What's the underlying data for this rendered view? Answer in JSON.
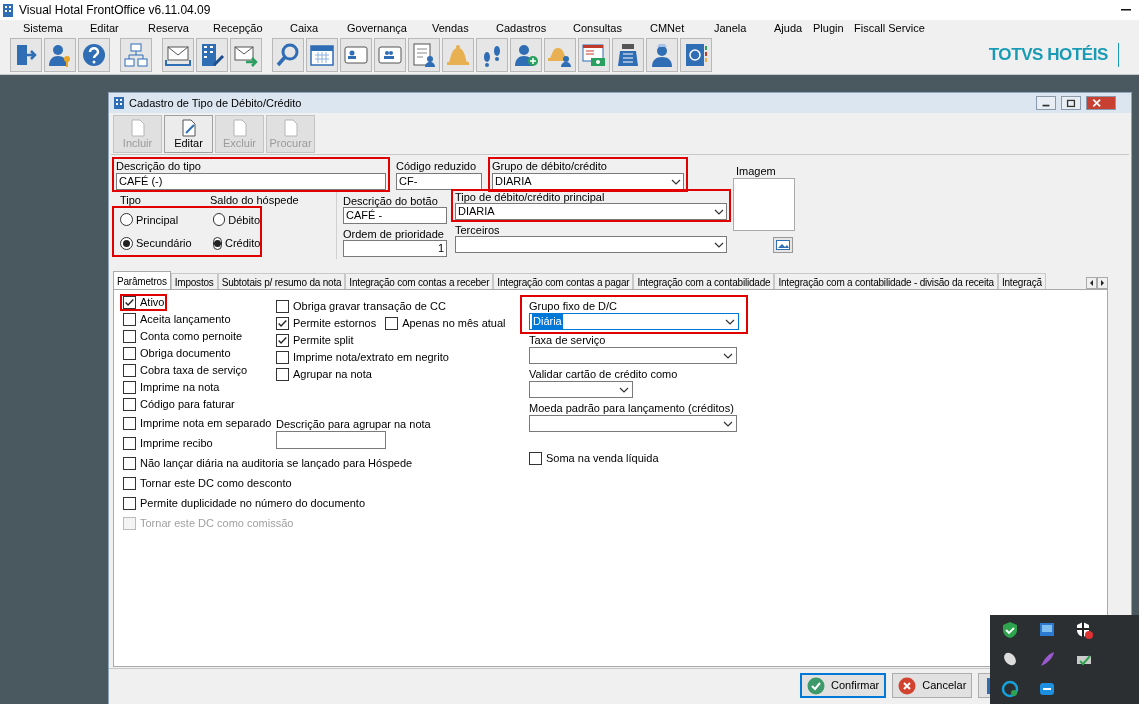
{
  "app": {
    "title": "Visual Hotal FrontOffice v6.11.04.09",
    "logo": "TOTVS HOTÉIS"
  },
  "menu": [
    "Sistema",
    "Editar",
    "Reserva",
    "Recepção",
    "Caixa",
    "Governança",
    "Vendas",
    "Cadastros",
    "Consultas",
    "CMNet",
    "Janela",
    "Ajuda",
    "Plugin",
    "Fiscall Service"
  ],
  "dialog": {
    "title": "Cadastro de Tipo de Débito/Crédito",
    "toolbar": [
      {
        "label": "Incluir",
        "disabled": true
      },
      {
        "label": "Editar",
        "disabled": false
      },
      {
        "label": "Excluir",
        "disabled": true
      },
      {
        "label": "Procurar",
        "disabled": true
      }
    ],
    "header_fields": [
      {
        "kind": "text",
        "label": "Descrição do tipo",
        "value": "CAFÉ (-)",
        "highlighted": true
      },
      {
        "kind": "text",
        "label": "Código reduzido",
        "value": "CF-",
        "highlighted": false
      },
      {
        "kind": "dropdown",
        "label": "Grupo de débito/crédito",
        "value": "DIARIA",
        "highlighted": true
      }
    ],
    "radio_block": {
      "highlighted": true,
      "groups": [
        {
          "title": "Tipo",
          "options": [
            {
              "label": "Principal",
              "selected": false
            },
            {
              "label": "Secundário",
              "selected": true
            }
          ]
        },
        {
          "title": "Saldo do hóspede",
          "options": [
            {
              "label": "Débito",
              "selected": false
            },
            {
              "label": "Crédito",
              "selected": true
            }
          ]
        }
      ]
    },
    "detail_fields": [
      {
        "kind": "text",
        "label": "Descrição do botão",
        "value": "CAFÉ -",
        "highlighted": false
      },
      {
        "kind": "number",
        "label": "Ordem de prioridade",
        "value": "1",
        "highlighted": false
      },
      {
        "kind": "dropdown",
        "label": "Tipo de débito/crédito principal",
        "value": "DIARIA",
        "highlighted": true
      },
      {
        "kind": "dropdown",
        "label": "Terceiros",
        "highlighted": false
      }
    ],
    "image_panel": {
      "title": "Imagem"
    },
    "tabs": [
      {
        "label": "Parâmetros",
        "selected": true
      },
      {
        "label": "Impostos",
        "selected": false
      },
      {
        "label": "Subtotais p/ resumo da nota",
        "selected": false
      },
      {
        "label": "Integração com contas a receber",
        "selected": false
      },
      {
        "label": "Integração com contas a pagar",
        "selected": false
      },
      {
        "label": "Integração com a contabilidade",
        "selected": false
      },
      {
        "label": "Integração com a contabilidade - divisão da receita",
        "selected": false
      },
      {
        "label": "Integraçã",
        "selected": false
      }
    ],
    "params": {
      "left": [
        {
          "label": "Ativo",
          "checked": true,
          "disabled": false,
          "highlighted": true
        },
        {
          "label": "Aceita lançamento",
          "checked": false,
          "disabled": false,
          "highlighted": false
        },
        {
          "label": "Conta como pernoite",
          "checked": false,
          "disabled": false,
          "highlighted": false
        },
        {
          "label": "Obriga documento",
          "checked": false,
          "disabled": false,
          "highlighted": false
        },
        {
          "label": "Cobra taxa de serviço",
          "checked": false,
          "disabled": false,
          "highlighted": false
        },
        {
          "label": "Imprime na nota",
          "checked": false,
          "disabled": false,
          "highlighted": false
        },
        {
          "label": "Código para faturar",
          "checked": false,
          "disabled": false,
          "highlighted": false
        },
        {
          "label": "Imprime nota em separado",
          "checked": false,
          "disabled": false,
          "highlighted": false
        },
        {
          "label": "Imprime recibo",
          "checked": false,
          "disabled": false,
          "highlighted": false
        },
        {
          "label": "Não lançar diária na auditoria se lançado para Hóspede",
          "checked": false,
          "disabled": false,
          "highlighted": false
        },
        {
          "label": "Tornar este DC como desconto",
          "checked": false,
          "disabled": false,
          "highlighted": false
        },
        {
          "label": "Permite duplicidade no número do documento",
          "checked": false,
          "disabled": false,
          "highlighted": false
        },
        {
          "label": "Tornar este DC como comissão",
          "checked": false,
          "disabled": true,
          "highlighted": false
        }
      ],
      "middle": [
        [
          {
            "label": "Obriga gravar transação de CC",
            "checked": false
          }
        ],
        [
          {
            "label": "Permite estornos",
            "checked": true
          },
          {
            "label": "Apenas no mês atual",
            "checked": false
          }
        ],
        [
          {
            "label": "Permite split",
            "checked": true
          }
        ],
        [
          {
            "label": "Imprime nota/extrato em negrito",
            "checked": false
          }
        ],
        [
          {
            "label": "Agrupar na nota",
            "checked": false
          }
        ]
      ],
      "group_note": {
        "label": "Descrição para agrupar na nota"
      },
      "right": [
        {
          "kind": "dropdown",
          "label": "Grupo fixo de D/C",
          "value": "Diária",
          "highlighted": true,
          "text_selected": true
        },
        {
          "kind": "dropdown",
          "label": "Taxa de serviço",
          "highlighted": false
        },
        {
          "kind": "dropdown",
          "label": "Validar cartão de crédito como",
          "highlighted": false
        },
        {
          "kind": "dropdown",
          "label": "Moeda padrão para lançamento (créditos)",
          "highlighted": false
        },
        {
          "kind": "checkbox",
          "label": "Soma na venda líquida",
          "checked": false
        }
      ]
    },
    "footer_buttons": [
      {
        "kind": "confirm",
        "label": "Confirmar",
        "focused": true
      },
      {
        "kind": "cancel",
        "label": "Cancelar",
        "focused": false
      },
      {
        "kind": "exit",
        "focused": false
      }
    ]
  }
}
